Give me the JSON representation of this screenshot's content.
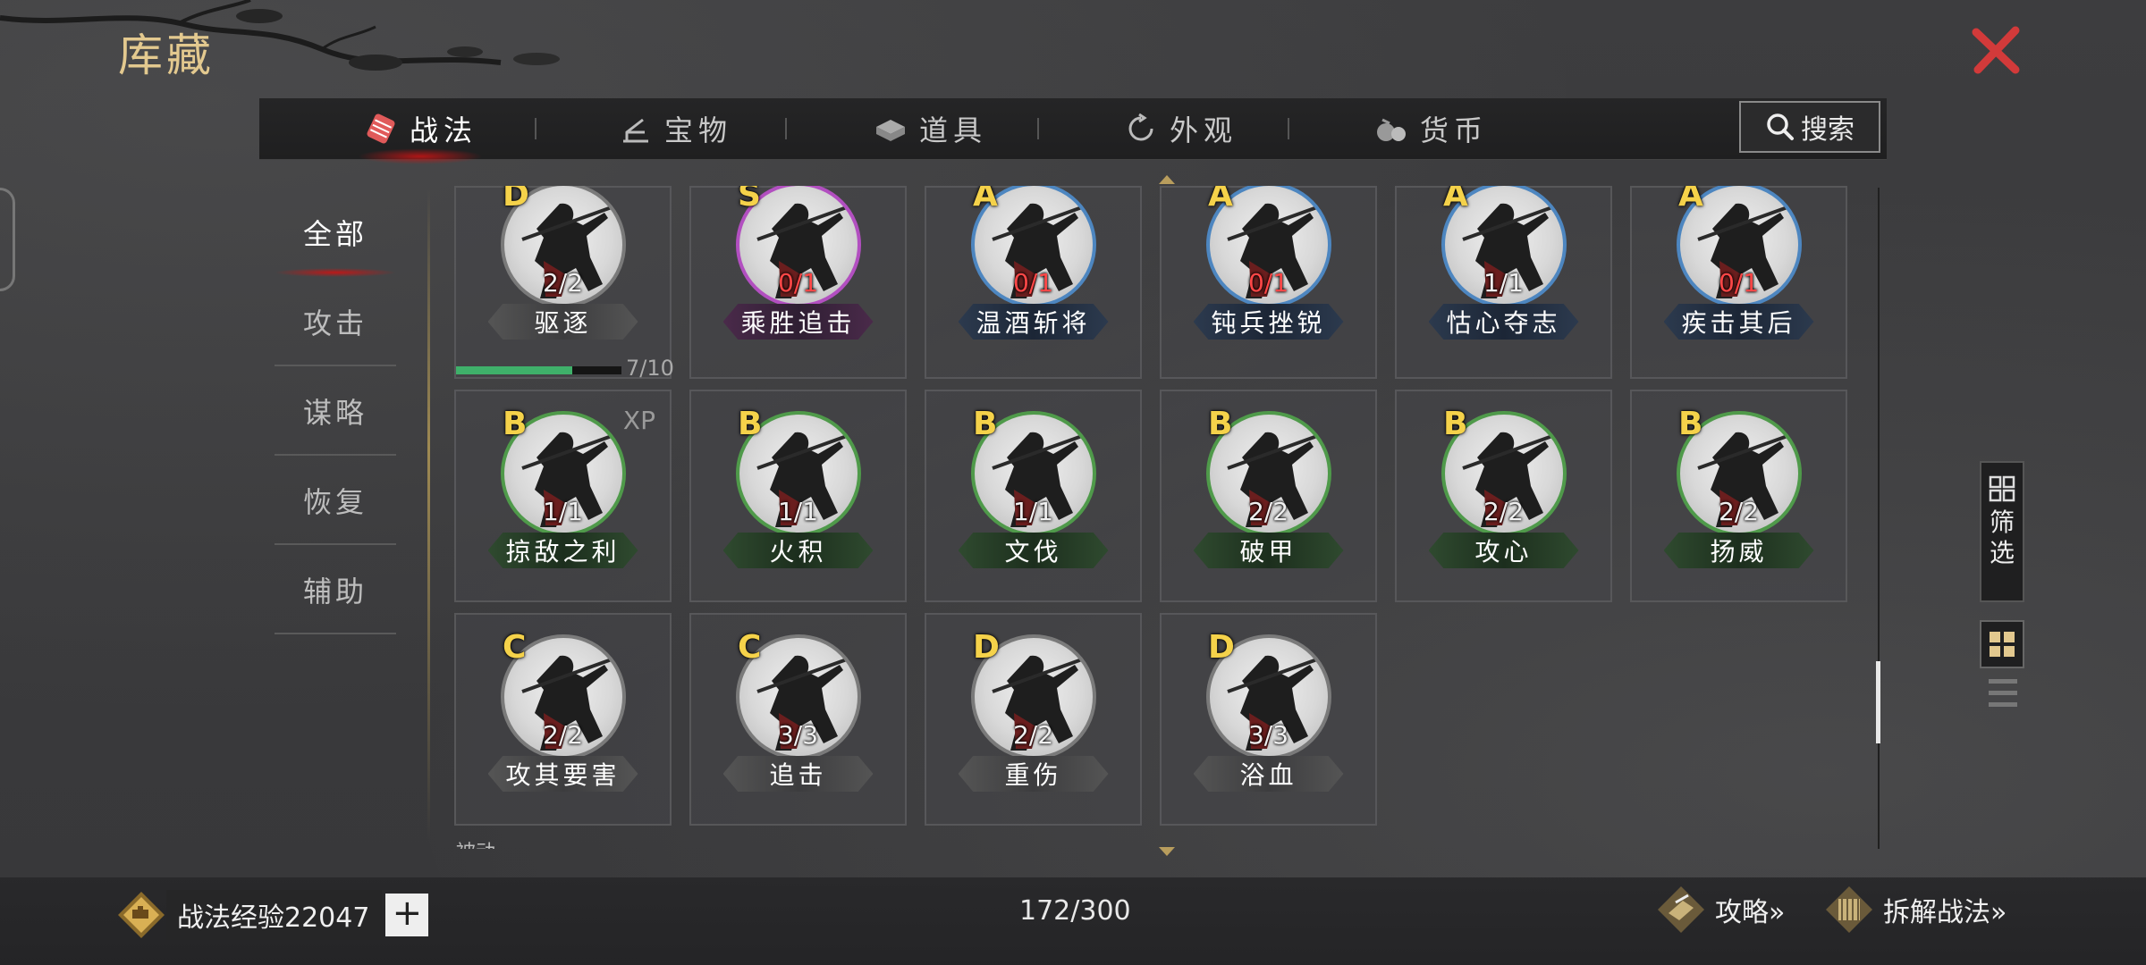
{
  "header": {
    "title": "库藏"
  },
  "tabs": [
    {
      "label": "战法",
      "icon": "tactics-icon",
      "active": true
    },
    {
      "label": "宝物",
      "icon": "treasure-icon",
      "active": false
    },
    {
      "label": "道具",
      "icon": "items-icon",
      "active": false
    },
    {
      "label": "外观",
      "icon": "appearance-icon",
      "active": false
    },
    {
      "label": "货币",
      "icon": "currency-icon",
      "active": false
    }
  ],
  "search": {
    "label": "搜索"
  },
  "categories": [
    {
      "label": "全部",
      "active": true
    },
    {
      "label": "攻击",
      "active": false
    },
    {
      "label": "谋略",
      "active": false
    },
    {
      "label": "恢复",
      "active": false
    },
    {
      "label": "辅助",
      "active": false
    }
  ],
  "cards": [
    {
      "grade": "D",
      "count": "2/2",
      "name": "驱逐",
      "color": "gray",
      "count_red": false
    },
    {
      "grade": "S",
      "count": "0/1",
      "name": "乘胜追击",
      "color": "purple",
      "count_red": true
    },
    {
      "grade": "A",
      "count": "0/1",
      "name": "温酒斩将",
      "color": "blue",
      "count_red": true
    },
    {
      "grade": "A",
      "count": "0/1",
      "name": "钝兵挫锐",
      "color": "blue",
      "count_red": true
    },
    {
      "grade": "A",
      "count": "1/1",
      "name": "怙心夺志",
      "color": "blue",
      "count_red": false
    },
    {
      "grade": "A",
      "count": "0/1",
      "name": "疾击其后",
      "color": "blue",
      "count_red": true
    },
    {
      "grade": "B",
      "count": "1/1",
      "name": "掠敌之利",
      "color": "green",
      "count_red": false,
      "tag": "XP"
    },
    {
      "grade": "B",
      "count": "1/1",
      "name": "火积",
      "color": "green",
      "count_red": false
    },
    {
      "grade": "B",
      "count": "1/1",
      "name": "文伐",
      "color": "green",
      "count_red": false
    },
    {
      "grade": "B",
      "count": "2/2",
      "name": "破甲",
      "color": "green",
      "count_red": false
    },
    {
      "grade": "B",
      "count": "2/2",
      "name": "攻心",
      "color": "green",
      "count_red": false
    },
    {
      "grade": "B",
      "count": "2/2",
      "name": "扬威",
      "color": "green",
      "count_red": false
    },
    {
      "grade": "C",
      "count": "2/2",
      "name": "攻其要害",
      "color": "gray",
      "count_red": false
    },
    {
      "grade": "C",
      "count": "3/3",
      "name": "追击",
      "color": "gray",
      "count_red": false
    },
    {
      "grade": "D",
      "count": "2/2",
      "name": "重伤",
      "color": "gray",
      "count_red": false
    },
    {
      "grade": "D",
      "count": "3/3",
      "name": "浴血",
      "color": "gray",
      "count_red": false
    }
  ],
  "first_card_exp": {
    "text": "7/10",
    "fraction": 0.7
  },
  "next_section_label": "被动",
  "filter": {
    "label": "筛选"
  },
  "bottom": {
    "exp_label": "战法经验22047",
    "plus": "+",
    "capacity": "172/300",
    "guide_label": "攻略»",
    "disassemble_label": "拆解战法»"
  },
  "colors": {
    "gray": "#7a7a7a",
    "purple": "#b24fc0",
    "blue": "#4d86c0",
    "green": "#4f9a4a",
    "accent_gold": "#e3c98f",
    "close_red": "#d23a3a"
  }
}
